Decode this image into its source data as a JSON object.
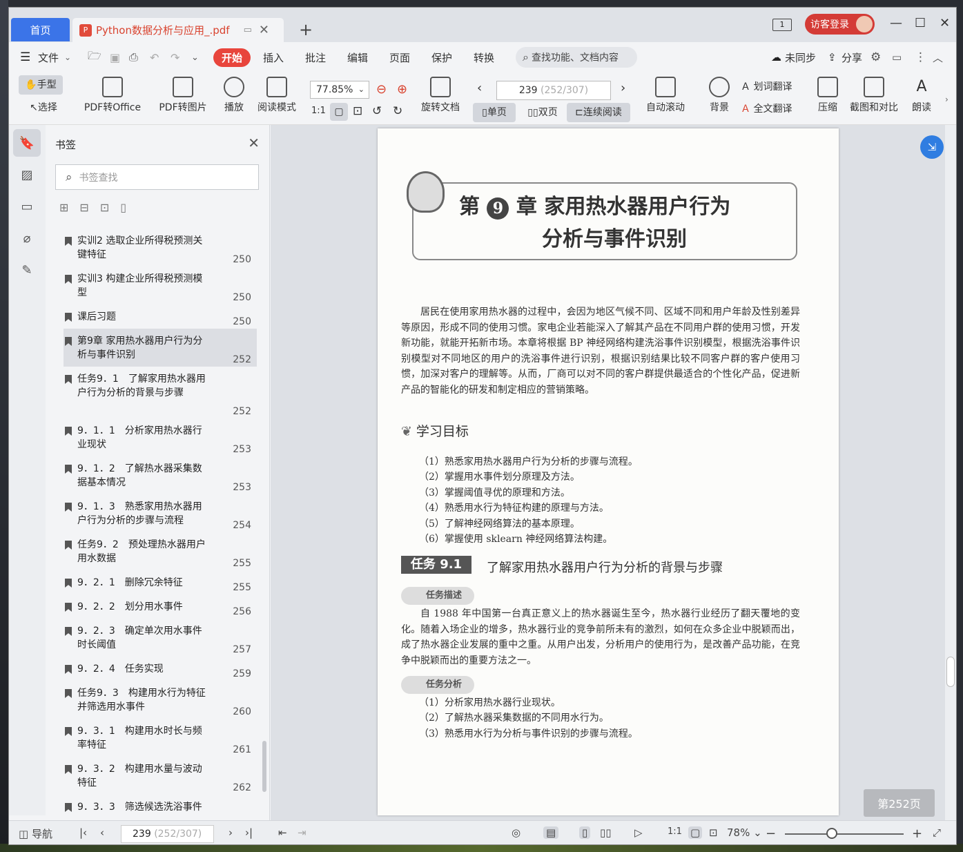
{
  "tabs": {
    "home_label": "首页",
    "doc_title": "Python数据分析与应用_.pdf",
    "pdf_icon": "pdf-icon",
    "add_symbol": "+"
  },
  "window": {
    "frame_icon_text": "1",
    "login_label": "访客登录",
    "min": "—",
    "max": "☐",
    "close": "✕"
  },
  "menu": {
    "file": "文件",
    "items": [
      "开始",
      "插入",
      "批注",
      "编辑",
      "页面",
      "保护",
      "转换"
    ],
    "search_placeholder": "查找功能、文档内容",
    "sync": "未同步",
    "share": "分享"
  },
  "ribbon": {
    "hand": "手型",
    "select": "选择",
    "pdf_to_office": "PDF转Office",
    "pdf_to_image": "PDF转图片",
    "play": "播放",
    "read_mode": "阅读模式",
    "zoom": "77.85%",
    "rotate": "旋转文档",
    "page_value": "239",
    "page_hint": "(252/307)",
    "single": "单页",
    "double": "双页",
    "continuous": "连续阅读",
    "auto_scroll": "自动滚动",
    "background": "背景",
    "word_translate": "划词翻译",
    "full_translate": "全文翻译",
    "compress": "压缩",
    "screenshot_compare": "截图和对比",
    "read_aloud": "朗读"
  },
  "panel": {
    "title": "书签",
    "search_placeholder": "书签查找",
    "bookmarks": [
      {
        "label": "实训2 选取企业所得税预测关键特征",
        "page": "250"
      },
      {
        "label": "实训3 构建企业所得税预测模型",
        "page": "250"
      },
      {
        "label": "课后习题",
        "page": "250"
      },
      {
        "label": "第9章 家用热水器用户行为分析与事件识别",
        "page": "252"
      },
      {
        "label": "任务9．1　了解家用热水器用户行为分析的背景与步骤",
        "page": "252"
      },
      {
        "label": "9．1．1　分析家用热水器行业现状",
        "page": "253"
      },
      {
        "label": "9．1．2　了解热水器采集数据基本情况",
        "page": "253"
      },
      {
        "label": "9．1．3　熟悉家用热水器用户行为分析的步骤与流程",
        "page": "254"
      },
      {
        "label": "任务9．2　预处理热水器用户用水数据",
        "page": "255"
      },
      {
        "label": "9．2．1　删除冗余特征",
        "page": "255"
      },
      {
        "label": "9．2．2　划分用水事件",
        "page": "256"
      },
      {
        "label": "9．2．3　确定单次用水事件时长阈值",
        "page": "257"
      },
      {
        "label": "9．2．4　任务实现",
        "page": "259"
      },
      {
        "label": "任务9．3　构建用水行为特征并筛选用水事件",
        "page": "260"
      },
      {
        "label": "9．3．1　构建用水时长与频率特征",
        "page": "261"
      },
      {
        "label": "9．3．2　构建用水量与波动特征",
        "page": "262"
      },
      {
        "label": "9．3．3　筛选候选洗浴事件",
        "page": ""
      }
    ]
  },
  "page": {
    "chapter_prefix": "第",
    "chapter_num": "9",
    "chapter_suffix": "章",
    "chapter_title_1": "家用热水器用户行为",
    "chapter_title_2": "分析与事件识别",
    "intro": "居民在使用家用热水器的过程中，会因为地区气候不同、区域不同和用户年龄及性别差异等原因，形成不同的使用习惯。家电企业若能深入了解其产品在不同用户群的使用习惯，开发新功能，就能开拓新市场。本章将根据 BP 神经网络构建洗浴事件识别模型，根据洗浴事件识别模型对不同地区的用户的洗浴事件进行识别，根据识别结果比较不同客户群的客户使用习惯，加深对客户的理解等。从而，厂商可以对不同的客户群提供最适合的个性化产品，促进新产品的智能化的研发和制定相应的营销策略。",
    "goals_heading": "学习目标",
    "goals": [
      "（1）熟悉家用热水器用户行为分析的步骤与流程。",
      "（2）掌握用水事件划分原理及方法。",
      "（3）掌握阈值寻优的原理和方法。",
      "（4）熟悉用水行为特征构建的原理与方法。",
      "（5）了解神经网络算法的基本原理。",
      "（6）掌握使用 sklearn 神经网络算法构建。"
    ],
    "task_label": "任务 9.1",
    "task_title": "了解家用热水器用户行为分析的背景与步骤",
    "desc_badge": "任务描述",
    "desc": "自 1988 年中国第一台真正意义上的热水器诞生至今，热水器行业经历了翻天覆地的变化。随着入场企业的增多，热水器行业的竞争前所未有的激烈，如何在众多企业中脱颖而出，成了热水器企业发展的重中之重。从用户出发，分析用户的使用行为，是改善产品功能，在竞争中脱颖而出的重要方法之一。",
    "analysis_badge": "任务分析",
    "analysis": [
      "（1）分析家用热水器行业现状。",
      "（2）了解热水器采集数据的不同用水行为。",
      "（3）熟悉用水行为分析与事件识别的步骤与流程。"
    ],
    "page_badge": "第252页"
  },
  "status": {
    "nav_label": "导航",
    "page_value": "239",
    "page_hint": "(252/307)",
    "zoom": "78%"
  }
}
